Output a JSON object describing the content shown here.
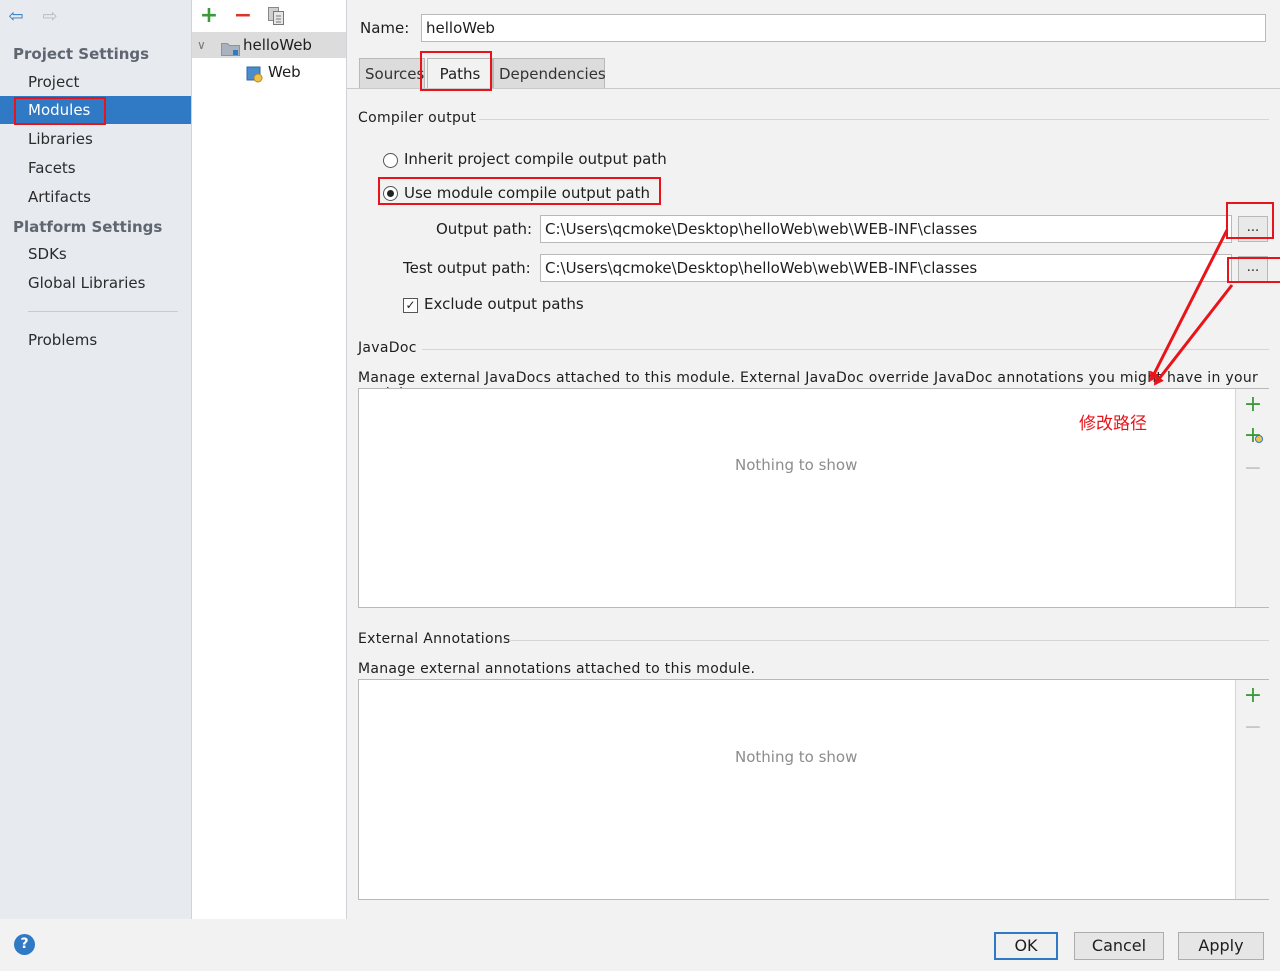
{
  "sidebar": {
    "project_settings_heading": "Project Settings",
    "platform_settings_heading": "Platform Settings",
    "items": [
      {
        "label": "Project"
      },
      {
        "label": "Modules"
      },
      {
        "label": "Libraries"
      },
      {
        "label": "Facets"
      },
      {
        "label": "Artifacts"
      },
      {
        "label": "SDKs"
      },
      {
        "label": "Global Libraries"
      },
      {
        "label": "Problems"
      }
    ],
    "selected": "Modules"
  },
  "tree": {
    "module": "helloWeb",
    "facet": "Web"
  },
  "module": {
    "name_label": "Name:",
    "name_value": "helloWeb",
    "tabs": [
      {
        "label": "Sources"
      },
      {
        "label": "Paths"
      },
      {
        "label": "Dependencies"
      }
    ],
    "active_tab": "Paths"
  },
  "compiler_output": {
    "title": "Compiler output",
    "inherit_label": "Inherit project compile output path",
    "use_module_label": "Use module compile output path",
    "selected_option": "use_module",
    "output_path_label": "Output path:",
    "output_path_value": "C:\\Users\\qcmoke\\Desktop\\helloWeb\\web\\WEB-INF\\classes",
    "test_output_path_label": "Test output path:",
    "test_output_path_value": "C:\\Users\\qcmoke\\Desktop\\helloWeb\\web\\WEB-INF\\classes",
    "browse_label": "...",
    "exclude_label": "Exclude output paths",
    "exclude_checked": true
  },
  "javadoc": {
    "title": "JavaDoc",
    "description": "Manage external JavaDocs attached to this module. External JavaDoc override JavaDoc annotations you might have in your module.",
    "empty_text": "Nothing to show"
  },
  "annotations": {
    "title": "External Annotations",
    "description": "Manage external annotations attached to this module.",
    "empty_text": "Nothing to show"
  },
  "annotation_note": "修改路径",
  "buttons": {
    "ok": "OK",
    "cancel": "Cancel",
    "apply": "Apply",
    "help": "?"
  },
  "colors": {
    "selection": "#2f79c5",
    "highlight_red": "#e8141a",
    "add_green": "#3c9a3c",
    "remove_red": "#d9362b"
  }
}
